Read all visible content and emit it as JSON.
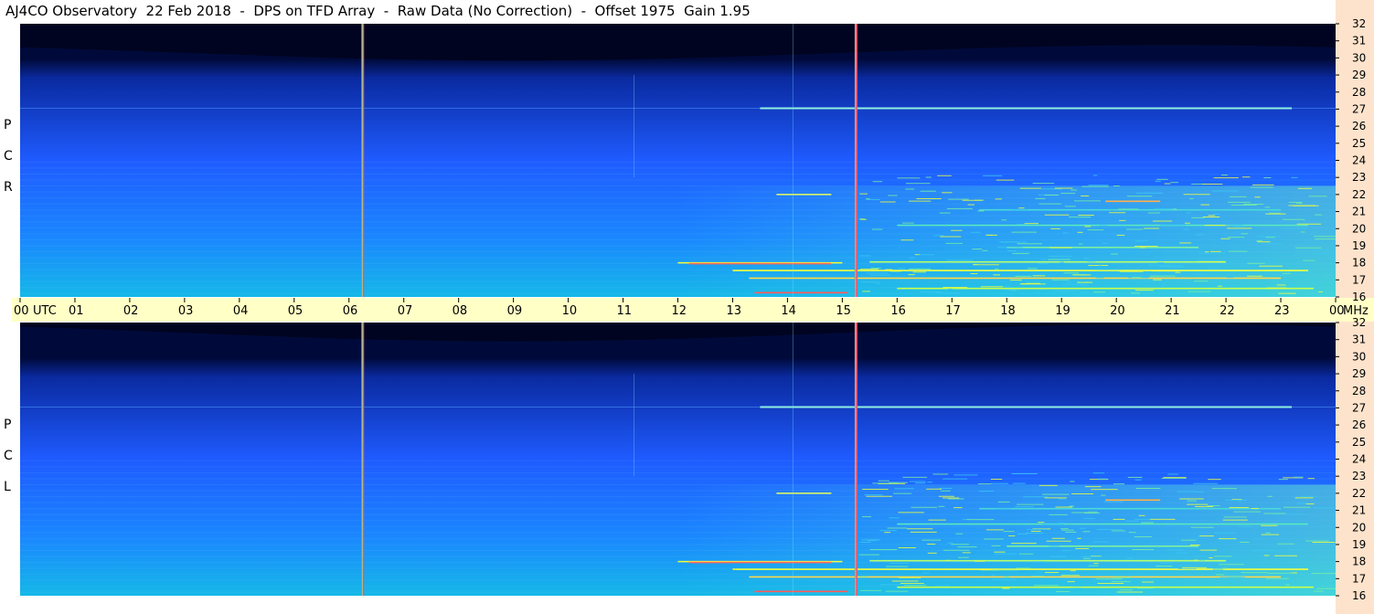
{
  "title": "AJ4CO Observatory  22 Feb 2018  -  DPS on TFD Array  -  Raw Data (No Correction)  -  Offset 1975  Gain 1.95",
  "panels": [
    {
      "id": "rcp",
      "label_letters": [
        "R",
        "C",
        "P"
      ]
    },
    {
      "id": "lcp",
      "label_letters": [
        "L",
        "C",
        "P"
      ]
    }
  ],
  "time_axis": {
    "first_label": "00",
    "unit": "UTC",
    "labels": [
      "01",
      "02",
      "03",
      "04",
      "05",
      "06",
      "07",
      "08",
      "09",
      "10",
      "11",
      "12",
      "13",
      "14",
      "15",
      "16",
      "17",
      "18",
      "19",
      "20",
      "21",
      "22",
      "23"
    ],
    "last_label": "00",
    "freq_unit": "MHz"
  },
  "chart_data": {
    "type": "heatmap",
    "title": "AJ4CO Observatory  22 Feb 2018  -  DPS on TFD Array  -  Raw Data (No Correction)  -  Offset 1975  Gain 1.95",
    "xlabel": "UTC",
    "ylabel": "MHz",
    "xlim": [
      0,
      24
    ],
    "ylim": [
      16,
      32
    ],
    "x_ticks": [
      "00",
      "01",
      "02",
      "03",
      "04",
      "05",
      "06",
      "07",
      "08",
      "09",
      "10",
      "11",
      "12",
      "13",
      "14",
      "15",
      "16",
      "17",
      "18",
      "19",
      "20",
      "21",
      "22",
      "23",
      "00"
    ],
    "y_ticks": [
      "16",
      "17",
      "18",
      "19",
      "20",
      "21",
      "22",
      "23",
      "24",
      "25",
      "26",
      "27",
      "28",
      "29",
      "30",
      "31",
      "32"
    ],
    "panels": [
      "RCP",
      "LCP"
    ],
    "colormap": [
      "#000a3a",
      "#0a2aa0",
      "#1f5bff",
      "#15b8e8",
      "#4ee8b0",
      "#f2ff3a",
      "#ff3a3a"
    ],
    "marker_lines_utc": [
      6.25,
      15.25
    ],
    "interference_bands_mhz": [
      27.05,
      21.6,
      18.0,
      17.6,
      17.1,
      16.3
    ],
    "note_colors": {
      "marker_line": "#ff4a6a",
      "background_plot": "#0f38d8"
    }
  }
}
